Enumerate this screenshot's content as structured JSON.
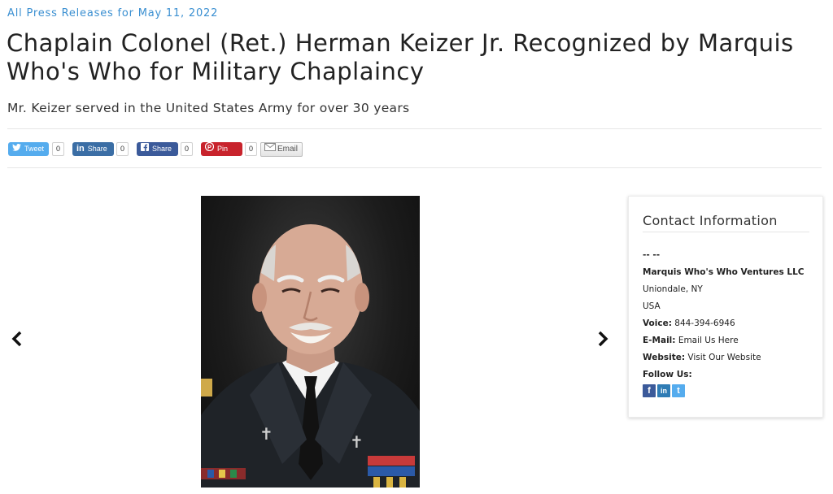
{
  "breadcrumb": "All Press Releases for May 11, 2022",
  "title": "Chaplain Colonel (Ret.) Herman Keizer Jr. Recognized by Marquis Who's Who for Military Chaplaincy",
  "subtitle": "Mr. Keizer served in the United States Army for over 30 years",
  "share": {
    "tweet": {
      "label": "Tweet",
      "count": "0",
      "icon": "twitter-bird-icon",
      "color": "#55acee"
    },
    "linkedin": {
      "label": "Share",
      "count": "0",
      "icon": "linkedin-icon",
      "color": "#3b6ea5"
    },
    "facebook": {
      "label": "Share",
      "count": "0",
      "icon": "facebook-icon",
      "color": "#3b5a9a"
    },
    "pinterest": {
      "label": "Pin",
      "count": "0",
      "icon": "pinterest-icon",
      "color": "#c8232c"
    },
    "email": {
      "label": "Email",
      "icon": "envelope-icon"
    }
  },
  "gallery": {
    "prev_icon": "chevron-left-icon",
    "next_icon": "chevron-right-icon",
    "image_description": "photo-portrait"
  },
  "contact": {
    "heading": "Contact Information",
    "dashes": "-- --",
    "company": "Marquis Who's Who Ventures LLC",
    "city": "Uniondale, NY",
    "country": "USA",
    "voice_label": "Voice:",
    "voice_value": "844-394-6946",
    "email_label": "E-Mail:",
    "email_value": "Email Us Here",
    "website_label": "Website:",
    "website_value": "Visit Our Website",
    "follow_label": "Follow Us:",
    "follow_icons": [
      "facebook-icon",
      "linkedin-icon",
      "twitter-icon"
    ]
  },
  "colors": {
    "link": "#3a8fd1",
    "twitter": "#55acee",
    "linkedin": "#3b6ea5",
    "facebook": "#3b5a9a",
    "pinterest": "#c8232c"
  }
}
